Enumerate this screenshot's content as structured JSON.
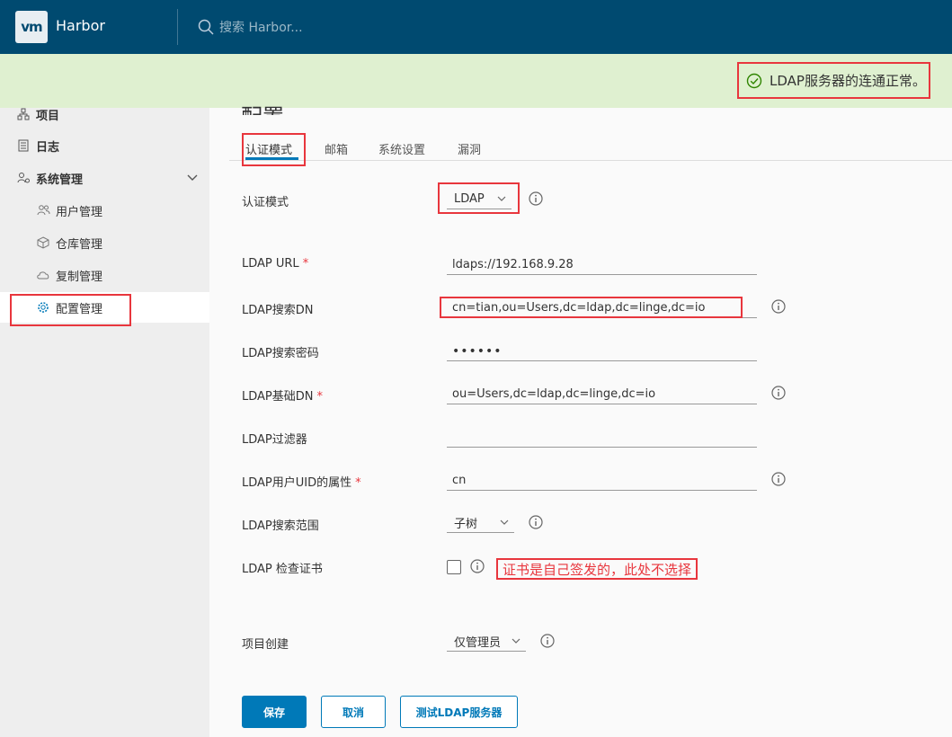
{
  "header": {
    "logo": "vm",
    "title": "Harbor",
    "search_placeholder": "搜索 Harbor..."
  },
  "banner": {
    "message": "LDAP服务器的连通正常。",
    "color": "#dff0d0"
  },
  "sidebar": {
    "items": [
      {
        "label": "项目",
        "icon": "project-icon"
      },
      {
        "label": "日志",
        "icon": "log-icon"
      },
      {
        "label": "系统管理",
        "icon": "admin-icon"
      },
      {
        "label": "用户管理",
        "icon": "users-icon"
      },
      {
        "label": "仓库管理",
        "icon": "box-icon"
      },
      {
        "label": "复制管理",
        "icon": "cloud-icon"
      },
      {
        "label": "配置管理",
        "icon": "gear-icon"
      }
    ]
  },
  "main": {
    "title": "配置",
    "tabs": [
      "认证模式",
      "邮箱",
      "系统设置",
      "漏洞"
    ],
    "form": {
      "auth_mode_label": "认证模式",
      "auth_mode_value": "LDAP",
      "ldap_url_label": "LDAP URL",
      "ldap_url_value": "ldaps://192.168.9.28",
      "search_dn_label": "LDAP搜索DN",
      "search_dn_value": "cn=tian,ou=Users,dc=ldap,dc=linge,dc=io",
      "search_pwd_label": "LDAP搜索密码",
      "search_pwd_value": "••••••",
      "base_dn_label": "LDAP基础DN",
      "base_dn_value": "ou=Users,dc=ldap,dc=linge,dc=io",
      "filter_label": "LDAP过滤器",
      "filter_value": "",
      "uid_label": "LDAP用户UID的属性",
      "uid_value": "cn",
      "scope_label": "LDAP搜索范围",
      "scope_value": "子树",
      "verify_cert_label": "LDAP 检查证书",
      "verify_cert_note": "证书是自己签发的，此处不选择",
      "project_creation_label": "项目创建",
      "project_creation_value": "仅管理员",
      "required_mark": "*"
    },
    "buttons": {
      "save": "保存",
      "cancel": "取消",
      "test": "测试LDAP服务器"
    }
  },
  "colors": {
    "header": "#004a70",
    "accent": "#0079b8",
    "annotation": "#e8363d"
  }
}
